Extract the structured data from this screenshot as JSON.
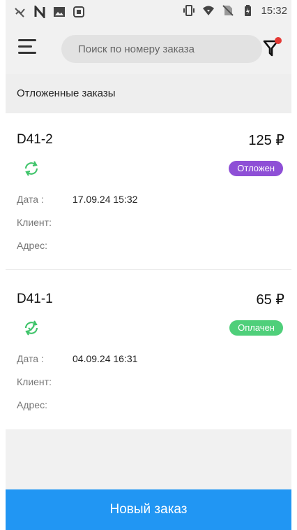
{
  "status_bar": {
    "time": "15:32",
    "icons_left": [
      "signal-off-icon",
      "n-icon",
      "image-icon",
      "screen-icon"
    ],
    "icons_right": [
      "vibrate-icon",
      "wifi-icon",
      "no-sim-icon",
      "battery-charging-icon"
    ]
  },
  "app_bar": {
    "search_placeholder": "Поиск по номеру заказа",
    "filter_active": true,
    "filter_dot_color": "#e53935"
  },
  "section": {
    "title": "Отложенные заказы"
  },
  "labels": {
    "date": "Дата :",
    "client": "Клиент:",
    "address": "Адрес:"
  },
  "orders": [
    {
      "id": "D41-2",
      "price": "125 ₽",
      "status_icon": "sync-icon",
      "status": "Отложен",
      "status_color": "#8e4fd6",
      "date": "17.09.24 15:32",
      "client": "",
      "address": ""
    },
    {
      "id": "D41-1",
      "price": "65 ₽",
      "status_icon": "sync-check-icon",
      "status": "Оплачен",
      "status_color": "#4fcf7a",
      "date": "04.09.24 16:31",
      "client": "",
      "address": ""
    }
  ],
  "new_order_button": "Новый заказ",
  "colors": {
    "accent": "#2196f3",
    "icon_green": "#3fc46a"
  }
}
